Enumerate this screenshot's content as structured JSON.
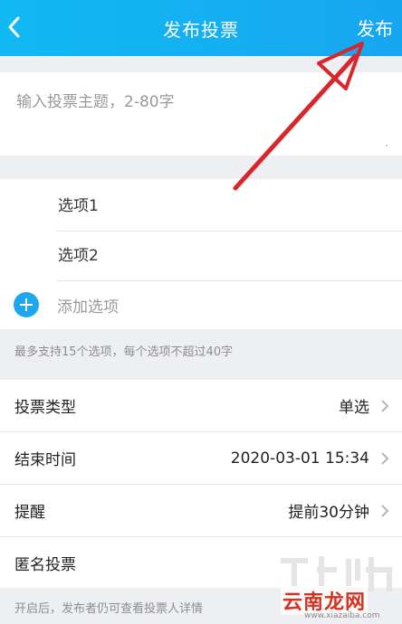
{
  "header": {
    "title": "发布投票",
    "publish_label": "发布"
  },
  "topic": {
    "placeholder": "输入投票主题，2-80字"
  },
  "options": {
    "items": [
      {
        "placeholder": "选项1"
      },
      {
        "placeholder": "选项2"
      }
    ],
    "add_label": "添加选项",
    "hint": "最多支持15个选项，每个选项不超过40字"
  },
  "settings": {
    "type_label": "投票类型",
    "type_value": "单选",
    "end_label": "结束时间",
    "end_value": "2020-03-01 15:34",
    "remind_label": "提醒",
    "remind_value": "提前30分钟",
    "anon_label": "匿名投票",
    "footer_hint": "开启后，发布者仍可查看投票人详情"
  },
  "watermark": {
    "text": "云南龙网",
    "url": "www.xiazaiba.com"
  },
  "colors": {
    "accent": "#1fa6ee",
    "annotation_arrow": "#d8262b"
  }
}
